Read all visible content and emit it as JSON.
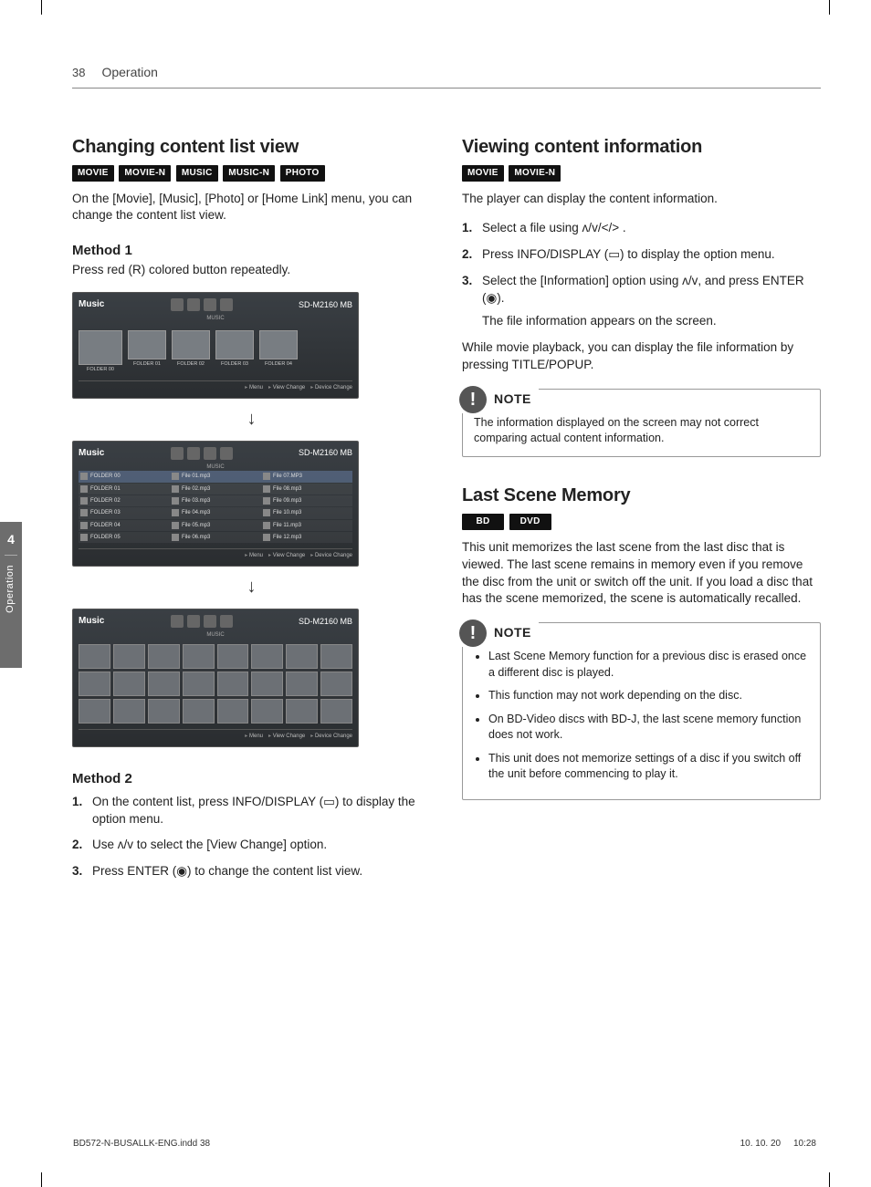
{
  "page": {
    "number": "38",
    "header": "Operation",
    "side_tab_num": "4",
    "side_tab_label": "Operation"
  },
  "left": {
    "h2": "Changing content list view",
    "badges": [
      "MOVIE",
      "MOVIE-N",
      "MUSIC",
      "MUSIC-N",
      "PHOTO"
    ],
    "intro": "On the [Movie], [Music], [Photo] or [Home Link] menu, you can change the content list view.",
    "method1_title": "Method 1",
    "method1_text": "Press red (R) colored button repeatedly.",
    "method2_title": "Method 2",
    "method2_steps": [
      "On the content list, press INFO/DISPLAY (▭) to display the option menu.",
      "Use ᴧ/ᴠ to select the [View Change] option.",
      "Press ENTER (◉) to change the content list view."
    ],
    "screens": {
      "title": "Music",
      "tabs_sub": "MUSIC",
      "disk_label": "SD-M2160 MB",
      "footer_items": [
        "Menu",
        "View Change",
        "Device Change"
      ],
      "folders": [
        "FOLDER 00",
        "FOLDER 01",
        "FOLDER 02",
        "FOLDER 03",
        "FOLDER 04"
      ],
      "list_folders": [
        "FOLDER 00",
        "FOLDER 01",
        "FOLDER 02",
        "FOLDER 03",
        "FOLDER 04",
        "FOLDER 05"
      ],
      "list_files_col1": [
        "File 01.mp3",
        "File 02.mp3",
        "File 03.mp3",
        "File 04.mp3",
        "File 05.mp3",
        "File 06.mp3"
      ],
      "list_files_col2": [
        "File 07.MP3",
        "File 08.mp3",
        "File 09.mp3",
        "File 10.mp3",
        "File 11.mp3",
        "File 12.mp3"
      ]
    }
  },
  "right": {
    "sec1_h2": "Viewing content information",
    "sec1_badges": [
      "MOVIE",
      "MOVIE-N"
    ],
    "sec1_intro": "The player can display the content information.",
    "sec1_steps": [
      "Select a file using ᴧ/ᴠ/</> .",
      "Press INFO/DISPLAY (▭) to display the option menu.",
      "Select the [Information] option using ᴧ/ᴠ, and press ENTER (◉)."
    ],
    "sec1_step3_sub": "The file information appears on the screen.",
    "sec1_after": "While movie playback, you can display the file information by pressing TITLE/POPUP.",
    "note1_label": "NOTE",
    "note1_text": "The information displayed on the screen may not correct comparing actual content information.",
    "sec2_h2": "Last Scene Memory",
    "sec2_badges": [
      "BD",
      "DVD"
    ],
    "sec2_text": "This unit memorizes the last scene from the last disc that is viewed. The last scene remains in memory even if you remove the disc from the unit or switch off the unit. If you load a disc that has the scene memorized, the scene is automatically recalled.",
    "note2_label": "NOTE",
    "note2_items": [
      "Last Scene Memory function for a previous disc is erased once a different disc is played.",
      "This function may not work depending on the disc.",
      "On BD-Video discs with BD-J, the last scene memory function does not work.",
      "This unit does not memorize settings of a disc if you switch off the unit before commencing to play it."
    ]
  },
  "footer": {
    "file": "BD572-N-BUSALLK-ENG.indd   38",
    "date": "10. 10. 20",
    "time": "10:28"
  }
}
